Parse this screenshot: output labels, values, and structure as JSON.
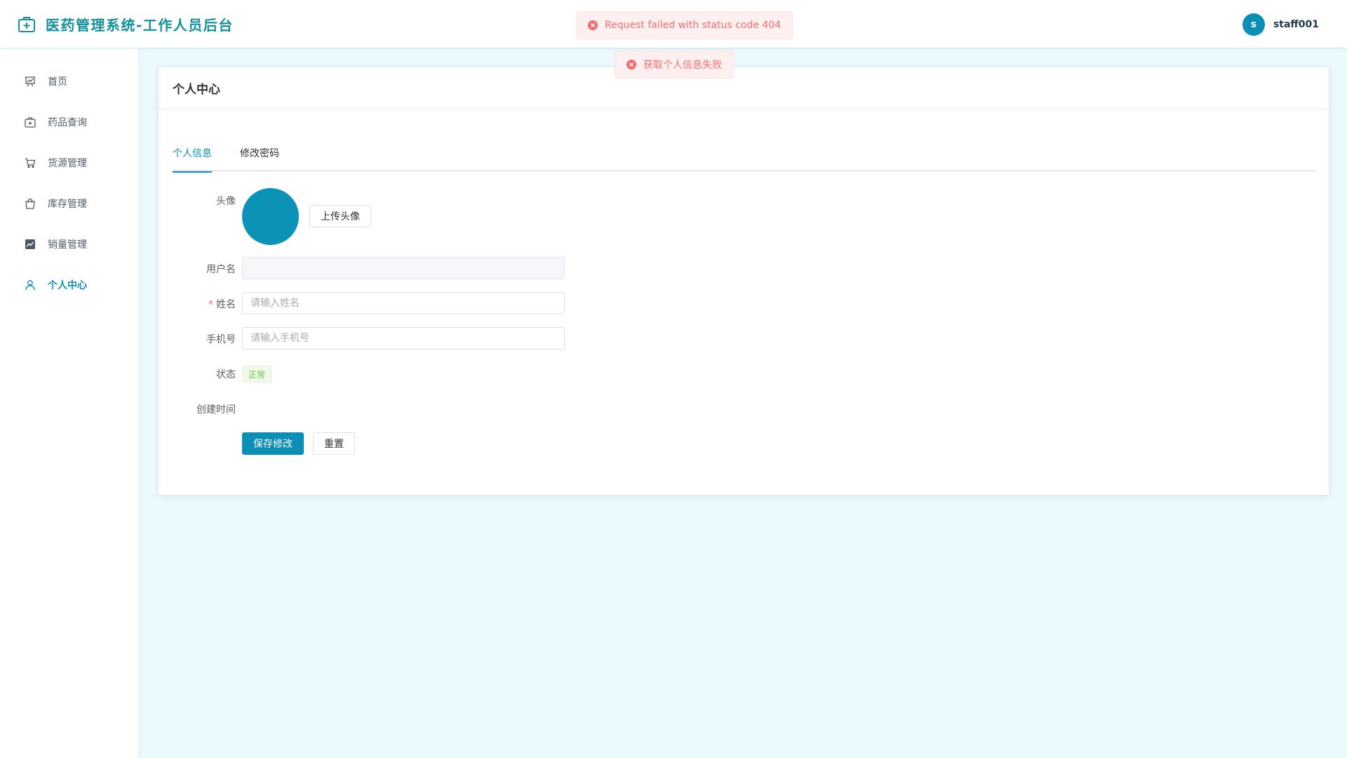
{
  "header": {
    "title": "医药管理系统-工作人员后台",
    "user_initial": "s",
    "username": "staff001"
  },
  "sidebar": {
    "items": [
      {
        "label": "首页",
        "icon": "presentation-chart-icon"
      },
      {
        "label": "药品查询",
        "icon": "medical-kit-icon"
      },
      {
        "label": "货源管理",
        "icon": "shopping-cart-icon"
      },
      {
        "label": "库存管理",
        "icon": "shopping-bag-icon"
      },
      {
        "label": "销量管理",
        "icon": "trend-chart-icon"
      },
      {
        "label": "个人中心",
        "icon": "user-icon",
        "active": true
      }
    ]
  },
  "card": {
    "title": "个人中心"
  },
  "tabs": [
    {
      "label": "个人信息",
      "active": true
    },
    {
      "label": "修改密码",
      "active": false
    }
  ],
  "form": {
    "avatar_label": "头像",
    "upload_button": "上传头像",
    "username_label": "用户名",
    "username_value": "",
    "name_label": "姓名",
    "name_required_mark": "*",
    "name_placeholder": "请输入姓名",
    "phone_label": "手机号",
    "phone_placeholder": "请输入手机号",
    "status_label": "状态",
    "status_value": "正常",
    "created_label": "创建时间",
    "created_value": "",
    "save_button": "保存修改",
    "reset_button": "重置"
  },
  "toasts": [
    {
      "message": "Request failed with status code 404",
      "type": "error"
    },
    {
      "message": "获取个人信息失败",
      "type": "error"
    }
  ],
  "colors": {
    "primary": "#0c8fb6",
    "brand_text": "#12909c",
    "page_background": "#ebfbfd",
    "error": "#f56c6c",
    "success": "#67c23a"
  }
}
